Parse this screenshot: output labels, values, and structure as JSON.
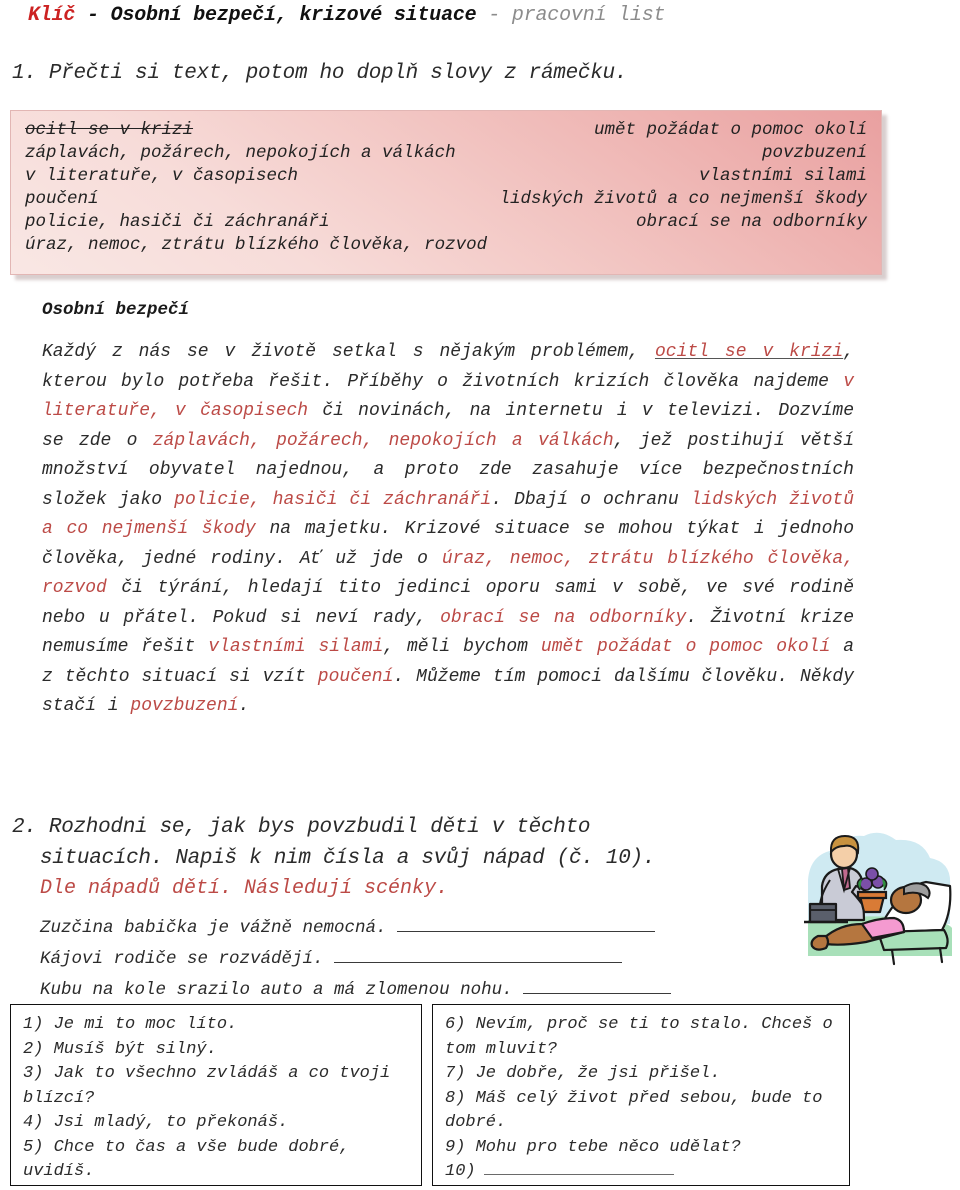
{
  "title": {
    "key_word": "Klíč",
    "separator_1": " - ",
    "main": "Osobní bezpečí, krizové situace",
    "separator_2": " - ",
    "subtitle": "pracovní list",
    "key_color": "#cc2222",
    "subtitle_color": "#8c8c8c"
  },
  "task1": {
    "instruction": "1. Přečti si text, potom ho doplň slovy z rámečku.",
    "wordbank": {
      "rows": [
        {
          "left": "ocitl se v krizi",
          "left_struck": true,
          "right": "umět požádat o pomoc okolí"
        },
        {
          "left": "záplavách, požárech, nepokojích a válkách",
          "left_struck": false,
          "right": "povzbuzení"
        },
        {
          "left": "v literatuře, v časopisech",
          "left_struck": false,
          "right": "vlastními silami"
        },
        {
          "left": "poučení",
          "left_struck": false,
          "right": "lidských životů a co nejmenší škody"
        },
        {
          "left": "policie, hasiči či záchranáři",
          "left_struck": false,
          "right": "obrací se na odborníky"
        },
        {
          "left": "úraz, nemoc, ztrátu blízkého člověka, rozvod",
          "left_struck": false,
          "right": ""
        }
      ]
    },
    "section_heading": "Osobní bezpečí",
    "answer_color": "#bc4a46",
    "body_segments": [
      {
        "text": "Každý z nás se v životě setkal s nějakým problémem, ",
        "style": "plain"
      },
      {
        "text": "ocitl se v krizi",
        "style": "answer-underlined"
      },
      {
        "text": ", kterou bylo potřeba řešit. Příběhy o životních krizích člověka najdeme ",
        "style": "plain"
      },
      {
        "text": "v literatuře, v časopisech",
        "style": "answer"
      },
      {
        "text": " či novinách, na internetu i v televizi. Dozvíme se zde o ",
        "style": "plain"
      },
      {
        "text": "záplavách, požárech, nepokojích a válkách",
        "style": "answer"
      },
      {
        "text": ", jež postihují větší množství obyvatel najednou, a proto zde zasahuje více bezpečnostních složek jako ",
        "style": "plain"
      },
      {
        "text": "policie, hasiči či záchranáři",
        "style": "answer"
      },
      {
        "text": ". Dbají o ochranu ",
        "style": "plain"
      },
      {
        "text": "lidských životů a co nejmenší škody",
        "style": "answer"
      },
      {
        "text": " na majetku. Krizové situace se mohou týkat i jednoho člověka, jedné rodiny. Ať už jde o ",
        "style": "plain"
      },
      {
        "text": "úraz, nemoc, ztrátu blízkého člověka, rozvod",
        "style": "answer"
      },
      {
        "text": " či týrání, hledají tito jedinci oporu sami v sobě, ve své rodině nebo u přátel. Pokud si neví rady, ",
        "style": "plain"
      },
      {
        "text": "obrací se na odborníky",
        "style": "answer"
      },
      {
        "text": ". Životní krize nemusíme řešit ",
        "style": "plain"
      },
      {
        "text": "vlastními silami",
        "style": "answer"
      },
      {
        "text": ", měli bychom ",
        "style": "plain"
      },
      {
        "text": "umět požádat o pomoc okolí",
        "style": "answer"
      },
      {
        "text": " a z těchto situací si vzít ",
        "style": "plain"
      },
      {
        "text": "poučení",
        "style": "answer"
      },
      {
        "text": ". Můžeme tím pomoci dalšímu člověku. Někdy stačí i ",
        "style": "plain"
      },
      {
        "text": "povzbuzení",
        "style": "answer"
      },
      {
        "text": ".",
        "style": "plain"
      }
    ]
  },
  "task2": {
    "instruction_line_1": "2. Rozhodni se, jak bys povzbudil děti v těchto",
    "instruction_line_2": "situacích. Napiš k nim čísla a svůj nápad (č. 10).",
    "answer_note": "Dle nápadů dětí. Následují scénky.",
    "scenarios": [
      "Zuzčina babička je vážně nemocná.",
      "Kájovi rodiče se rozvádějí.",
      "Kubu na kole srazilo auto a má zlomenou nohu."
    ],
    "illustration_alt": "woman-with-flowers-visiting-resting-person"
  },
  "phrases": {
    "left_column": [
      "1) Je mi to moc líto.",
      "2) Musíš být silný.",
      "3) Jak to všechno zvládáš a co tvoji blízcí?",
      "4) Jsi mladý, to překonáš.",
      "5) Chce to čas a vše bude dobré, uvidíš."
    ],
    "right_column": [
      "6) Nevím, proč se ti to stalo. Chceš o tom mluvit?",
      "7) Je dobře, že jsi přišel.",
      "8) Máš celý život před sebou, bude to dobré.",
      "9) Mohu pro tebe něco udělat?"
    ],
    "right_blank_number": "10)"
  }
}
